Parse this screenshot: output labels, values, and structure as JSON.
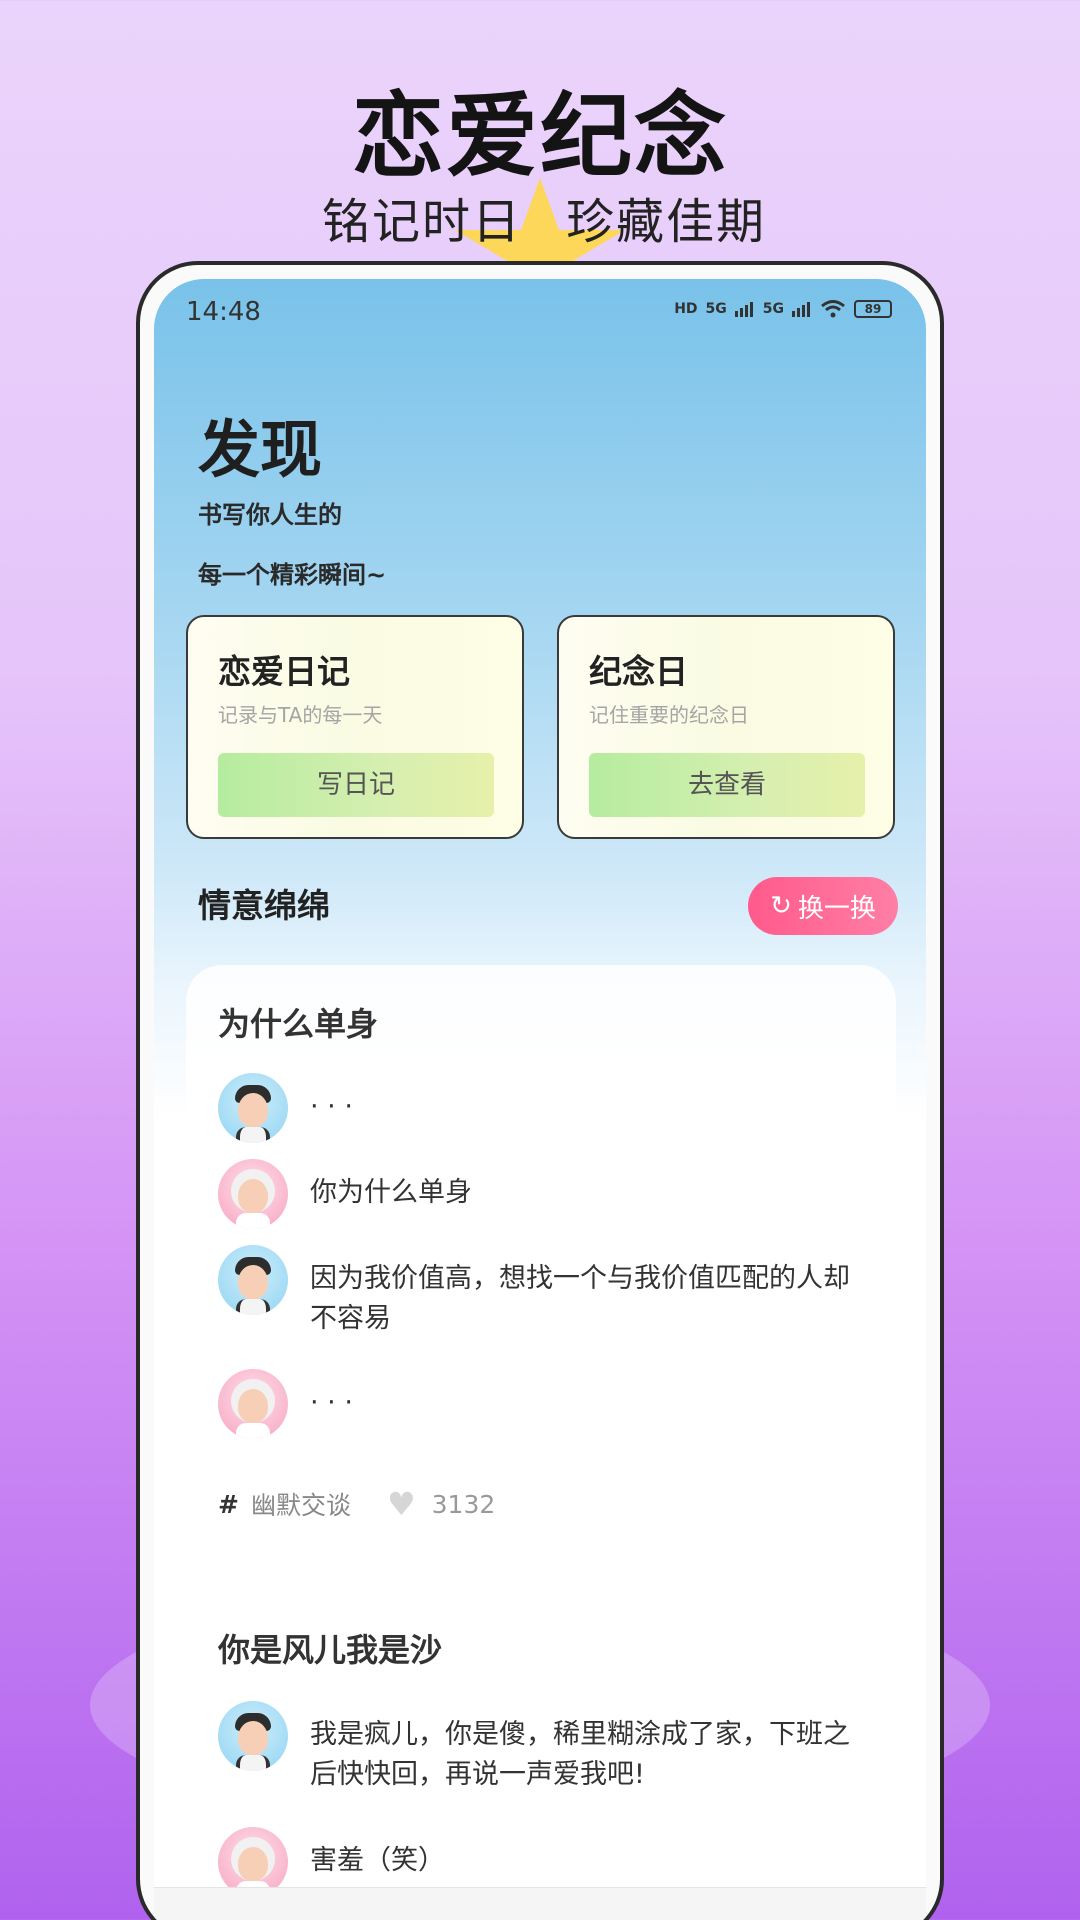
{
  "promo": {
    "title": "恋爱纪念",
    "subtitle_left": "铭记时日",
    "subtitle_right": "珍藏佳期"
  },
  "status_bar": {
    "time": "14:48",
    "icons": [
      "hd-icon",
      "5g-signal-icon",
      "5g-signal-icon",
      "wifi-icon",
      "battery-icon"
    ],
    "hd": "HD",
    "net1": "5G",
    "net2": "5G",
    "battery": "89"
  },
  "header": {
    "title": "发现",
    "subtitle_line1": "书写你人生的",
    "subtitle_line2": "每一个精彩瞬间~"
  },
  "cards": [
    {
      "title": "恋爱日记",
      "desc": "记录与TA的每一天",
      "button": "写日记"
    },
    {
      "title": "纪念日",
      "desc": "记住重要的纪念日",
      "button": "去查看"
    }
  ],
  "section": {
    "title": "情意绵绵",
    "swap_button": "换一换"
  },
  "posts": [
    {
      "title": "为什么单身",
      "messages": [
        {
          "speaker": "boy",
          "text": "· · ·"
        },
        {
          "speaker": "girl",
          "text": "你为什么单身"
        },
        {
          "speaker": "boy",
          "text": "因为我价值高，想找一个与我价值匹配的人却不容易"
        },
        {
          "speaker": "girl",
          "text": "· · ·"
        }
      ],
      "tag": "幽默交谈",
      "likes": "3132"
    },
    {
      "title": "你是风儿我是沙",
      "messages": [
        {
          "speaker": "boy",
          "text": "我是疯儿，你是傻，稀里糊涂成了家，下班之后快快回，再说一声爱我吧!"
        },
        {
          "speaker": "girl",
          "text": "害羞（笑）"
        }
      ]
    }
  ],
  "colors": {
    "accent_pink": "#ff5a8b",
    "card_button_green": "#b5ec9f",
    "star_yellow": "#fcd75a"
  }
}
